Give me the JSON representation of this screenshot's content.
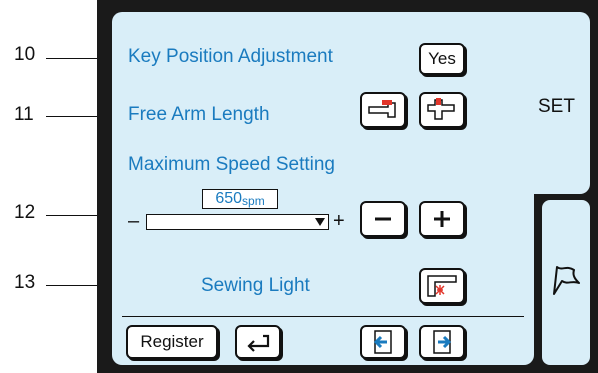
{
  "callouts": [
    "10",
    "11",
    "12",
    "13"
  ],
  "settings": {
    "key_position": {
      "label": "Key Position Adjustment",
      "button": "Yes"
    },
    "free_arm": {
      "label": "Free Arm Length"
    },
    "max_speed": {
      "label": "Maximum Speed Setting",
      "value": "650",
      "unit": "spm",
      "minus_sign": "–",
      "plus_sign": "+",
      "level": 1.0
    },
    "sewing_light": {
      "label": "Sewing Light"
    }
  },
  "tabs": {
    "set": "SET"
  },
  "footer": {
    "register": "Register"
  },
  "colors": {
    "panel": "#d9eef8",
    "accent_blue": "#1a7bbf",
    "accent_red": "#e2352a"
  },
  "icons": [
    "free-arm-short-icon",
    "free-arm-long-icon",
    "minus-icon",
    "plus-icon",
    "sewing-light-icon",
    "return-icon",
    "page-back-icon",
    "page-forward-icon",
    "flag-icon",
    "dropdown-arrow-icon"
  ]
}
